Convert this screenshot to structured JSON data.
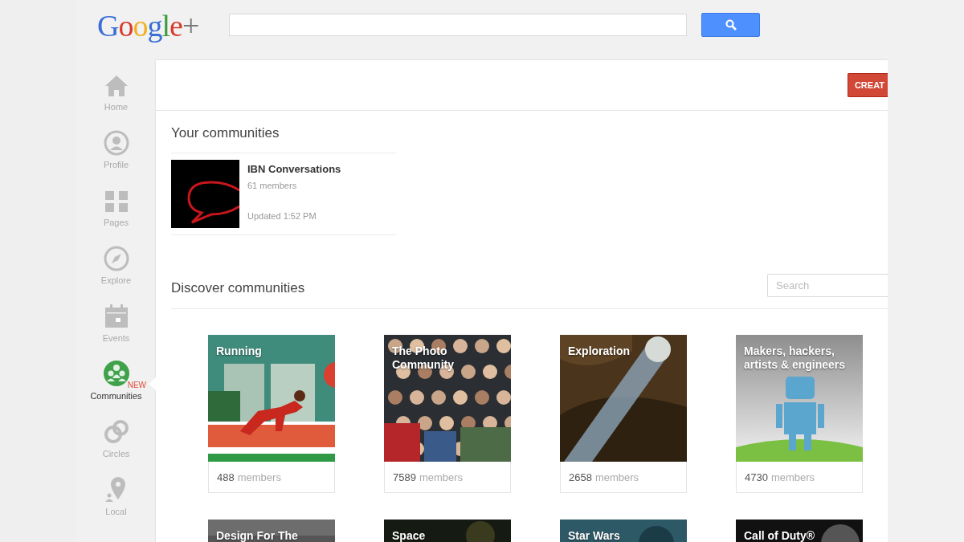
{
  "header": {
    "logo": "Google+"
  },
  "sidebar": {
    "items": [
      {
        "label": "Home",
        "selected": false
      },
      {
        "label": "Profile",
        "selected": false
      },
      {
        "label": "Pages",
        "selected": false
      },
      {
        "label": "Explore",
        "selected": false
      },
      {
        "label": "Events",
        "selected": false
      },
      {
        "label": "Communities",
        "selected": true,
        "badge": "NEW"
      },
      {
        "label": "Circles",
        "selected": false
      },
      {
        "label": "Local",
        "selected": false
      }
    ]
  },
  "toolbar": {
    "create_button": "CREAT"
  },
  "your_communities": {
    "title": "Your communities",
    "items": [
      {
        "name": "IBN Conversations",
        "members": "61 members",
        "updated": "Updated 1:52 PM"
      }
    ]
  },
  "discover": {
    "title": "Discover communities",
    "search": {
      "placeholder": "Search"
    },
    "cards": [
      {
        "title": "Running",
        "count": "488",
        "unit": "members"
      },
      {
        "title": "The Photo Community",
        "count": "7589",
        "unit": "members"
      },
      {
        "title": "Exploration",
        "count": "2658",
        "unit": "members"
      },
      {
        "title": "Makers, hackers, artists & engineers",
        "count": "4730",
        "unit": "members"
      },
      {
        "title": "Design For The"
      },
      {
        "title": "Space"
      },
      {
        "title": "Star Wars"
      },
      {
        "title": "Call of Duty®"
      }
    ]
  }
}
